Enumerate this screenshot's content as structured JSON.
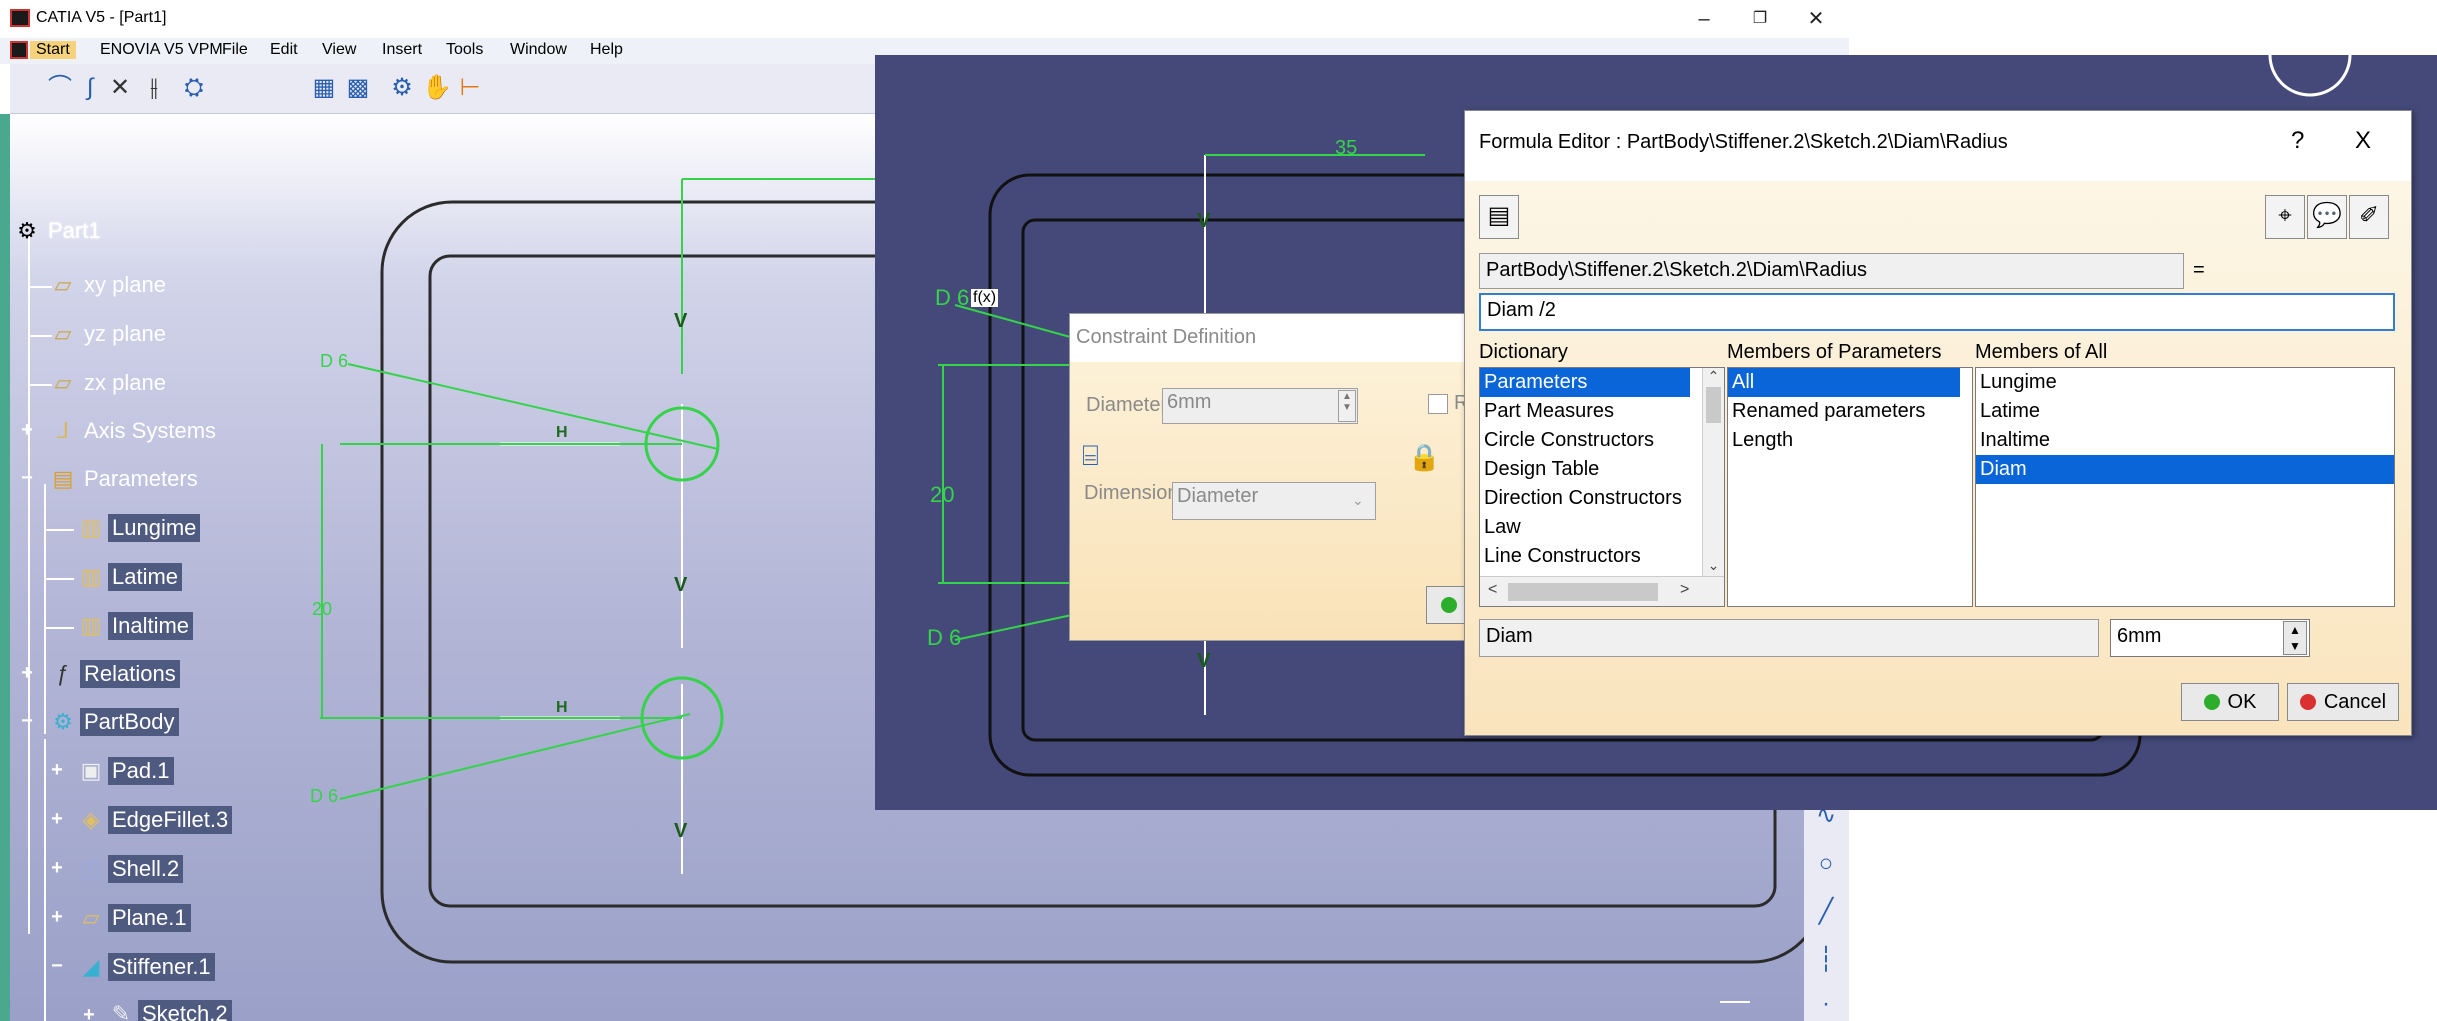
{
  "window": {
    "title": "CATIA V5 - [Part1]",
    "controls": {
      "minimize": "–",
      "restore": "❐",
      "close": "✕"
    }
  },
  "menubar": {
    "items": [
      "Start",
      "ENOVIA V5 VPM",
      "File",
      "Edit",
      "View",
      "Insert",
      "Tools",
      "Window",
      "Help"
    ]
  },
  "tree": {
    "root": "Part1",
    "items": [
      {
        "label": "xy plane",
        "icon": "plane-icon"
      },
      {
        "label": "yz plane",
        "icon": "plane-icon"
      },
      {
        "label": "zx plane",
        "icon": "plane-icon"
      },
      {
        "label": "Axis Systems",
        "icon": "axis-system-icon"
      },
      {
        "label": "Parameters",
        "icon": "parameters-icon"
      },
      {
        "label": "Lungime",
        "icon": "parameter-icon"
      },
      {
        "label": "Latime",
        "icon": "parameter-icon"
      },
      {
        "label": "Inaltime",
        "icon": "parameter-icon"
      },
      {
        "label": "Relations",
        "icon": "relations-icon"
      },
      {
        "label": "PartBody",
        "icon": "partbody-icon"
      },
      {
        "label": "Pad.1",
        "icon": "pad-icon"
      },
      {
        "label": "EdgeFillet.3",
        "icon": "edgefillet-icon"
      },
      {
        "label": "Shell.2",
        "icon": "shell-icon"
      },
      {
        "label": "Plane.1",
        "icon": "plane-icon"
      },
      {
        "label": "Stiffener.1",
        "icon": "stiffener-icon"
      },
      {
        "label": "Sketch.2",
        "icon": "sketch-icon"
      }
    ]
  },
  "sketch": {
    "dim_d6_a": "D 6",
    "dim_d6_b": "D 6",
    "dim_20": "20",
    "h_label": "H",
    "v_label": "V",
    "overlay_dim_35": "35",
    "overlay_dim_20": "20",
    "overlay_d6_a": "D 6",
    "overlay_d6_b": "D 6",
    "fx_marker": "f(x)"
  },
  "constraint_dialog": {
    "title": "Constraint Definition",
    "diameter_label": "Diameter",
    "diameter_value": "6mm",
    "dimension_label": "Dimension",
    "dimension_value": "Diameter",
    "checkbox_label": "R"
  },
  "formula_editor": {
    "title": "Formula Editor : PartBody\\Stiffener.2\\Sketch.2\\Diam\\Radius",
    "help": "?",
    "close": "X",
    "parameter_path": "PartBody\\Stiffener.2\\Sketch.2\\Diam\\Radius",
    "equals": "=",
    "formula_text": "Diam /2",
    "dictionary_header": "Dictionary",
    "members_params_header": "Members of Parameters",
    "members_all_header": "Members of All",
    "dictionary": [
      "Parameters",
      "Part Measures",
      "Circle Constructors",
      "Design Table",
      "Direction Constructors",
      "Law",
      "Line Constructors"
    ],
    "members_params": [
      "All",
      "Renamed parameters",
      "Length"
    ],
    "members_all": [
      "Lungime",
      "Latime",
      "Inaltime",
      "Diam"
    ],
    "selected_name": "Diam",
    "selected_value": "6mm",
    "ok_label": "OK",
    "cancel_label": "Cancel"
  },
  "colors": {
    "sketch_green": "#34d34a",
    "tree_highlight": "#4f5a80",
    "selection_blue": "#0a66d8",
    "overlay_bg": "#44497a"
  }
}
